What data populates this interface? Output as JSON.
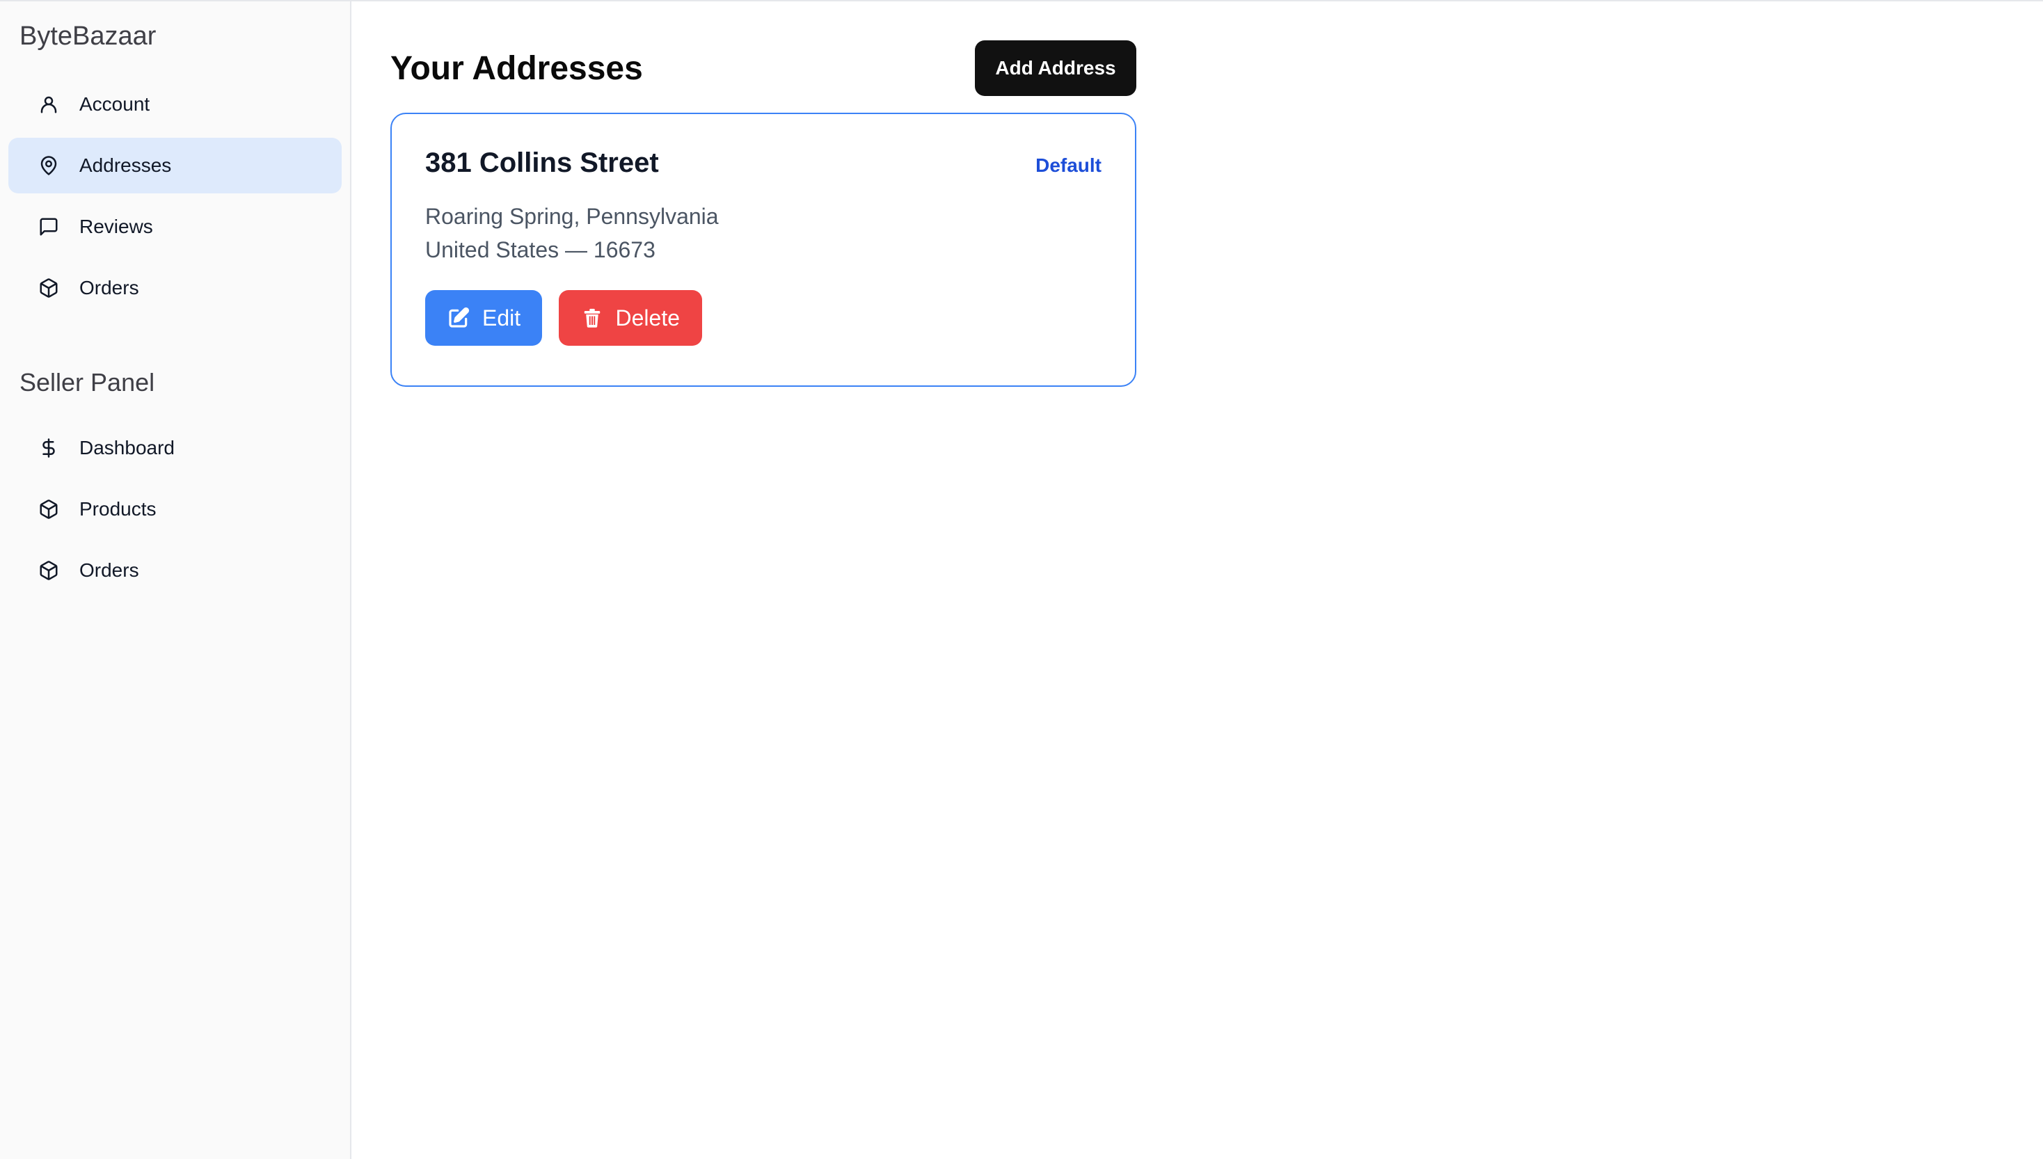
{
  "sidebar": {
    "brand": "ByteBazaar",
    "account_items": [
      {
        "label": "Account",
        "icon": "user-icon"
      },
      {
        "label": "Addresses",
        "icon": "map-pin-icon",
        "active": true
      },
      {
        "label": "Reviews",
        "icon": "message-square-icon"
      },
      {
        "label": "Orders",
        "icon": "package-icon"
      }
    ],
    "seller_title": "Seller Panel",
    "seller_items": [
      {
        "label": "Dashboard",
        "icon": "dollar-icon"
      },
      {
        "label": "Products",
        "icon": "package-icon"
      },
      {
        "label": "Orders",
        "icon": "package-icon"
      }
    ]
  },
  "main": {
    "title": "Your Addresses",
    "add_button": "Add Address",
    "addresses": [
      {
        "street": "381 Collins Street",
        "badge": "Default",
        "line1": "Roaring Spring, Pennsylvania",
        "line2": "United States — 16673",
        "edit_label": "Edit",
        "delete_label": "Delete"
      }
    ]
  },
  "colors": {
    "accent": "#3b82f6",
    "danger": "#ef4444",
    "active_nav": "#deeafc",
    "default_badge": "#1d4ed8"
  }
}
